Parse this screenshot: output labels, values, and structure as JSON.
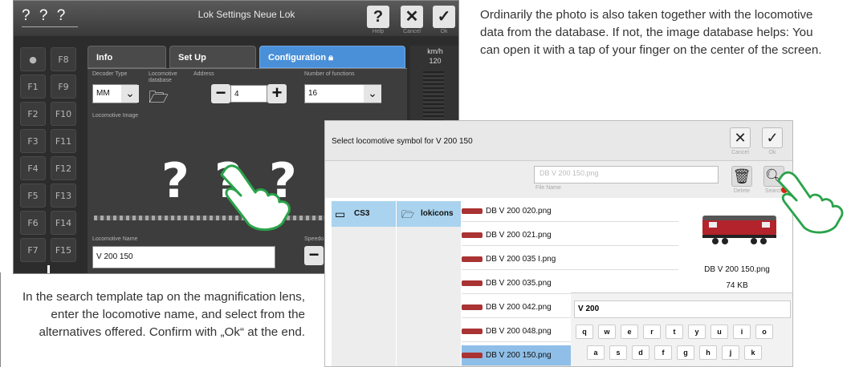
{
  "lok_screen": {
    "title_placeholder": "? ? ?",
    "title": "Lok Settings Neue Lok",
    "help_label": "Help",
    "cancel_label": "Cancel",
    "ok_label": "Ok",
    "function_keys_left": [
      "",
      "F1",
      "F2",
      "F3",
      "F4",
      "F5",
      "F6",
      "F7"
    ],
    "function_keys_right": [
      "F8",
      "F9",
      "F10",
      "F11",
      "F12",
      "F13",
      "F14",
      "F15"
    ],
    "tabs": [
      "Info",
      "Set Up",
      "Configuration"
    ],
    "decoder_label": "Decoder Type",
    "decoder_value": "MM",
    "lok_db_label": "Locomotive database",
    "address_label": "Address",
    "address_value": "4",
    "functions_label": "Number of functions",
    "functions_value": "16",
    "image_label": "Locomotive Image",
    "name_label": "Locomotive Name",
    "name_value": "V 200 150",
    "speed_unit": "km/h",
    "speed_value": "120",
    "speedo_label": "Speedo"
  },
  "texts": {
    "top_right": "Ordinarily the photo is also taken together with the locomotive data from the database. If not, the image database helps: You can open it with a tap of your finger on the center of the screen.",
    "bottom_left": "In the search template tap on the magnification lens, enter the locomotive name, and select from the alternatives offered. Confirm with „Ok“ at the end."
  },
  "symbol_screen": {
    "title": "Select locomotive symbol for V 200 150",
    "cancel_label": "Cancel",
    "ok_label": "Ok",
    "search_value": "DB V 200 150.png",
    "file_name_label": "File Name",
    "delete_label": "Delete",
    "search_label": "Search",
    "source": "CS3",
    "folder": "lokicons",
    "files": [
      "DB V 200 020.png",
      "DB V 200 021.png",
      "DB V 200 035 I.png",
      "DB V 200 035.png",
      "DB V 200 042.png",
      "DB V 200 048.png",
      "DB V 200 150.png"
    ],
    "preview_name": "DB V 200 150.png",
    "preview_size": "74 KB",
    "keyboard_input": "V 200",
    "keys_row1": [
      "q",
      "w",
      "e",
      "r",
      "t",
      "y",
      "u",
      "i",
      "o"
    ],
    "keys_row2": [
      "a",
      "s",
      "d",
      "f",
      "g",
      "h",
      "j",
      "k"
    ]
  },
  "colors": {
    "accent_blue": "#4a90d9",
    "touch_green": "#2aa34a"
  }
}
